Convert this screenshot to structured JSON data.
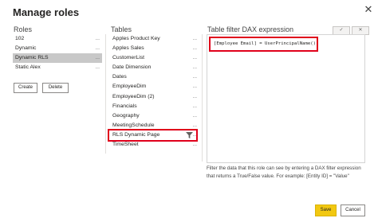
{
  "dialog": {
    "title": "Manage roles",
    "close_icon": "close-icon"
  },
  "roles": {
    "header": "Roles",
    "items": [
      {
        "label": "102",
        "dots": "...",
        "selected": false
      },
      {
        "label": "Dynamic",
        "dots": "...",
        "selected": false
      },
      {
        "label": "Dynamic RLS",
        "dots": "...",
        "selected": true
      },
      {
        "label": "Static Alex",
        "dots": "...",
        "selected": false
      }
    ],
    "create_label": "Create",
    "delete_label": "Delete"
  },
  "tables": {
    "header": "Tables",
    "items": [
      {
        "label": "Apples Product Key",
        "dots": "..."
      },
      {
        "label": "Apples Sales",
        "dots": "..."
      },
      {
        "label": "CustomerList",
        "dots": "..."
      },
      {
        "label": "Date Dimension",
        "dots": "..."
      },
      {
        "label": "Dates",
        "dots": "..."
      },
      {
        "label": "EmployeeDim",
        "dots": "..."
      },
      {
        "label": "EmployeeDim (2)",
        "dots": "..."
      },
      {
        "label": "Financials",
        "dots": "..."
      },
      {
        "label": "Geography",
        "dots": "..."
      },
      {
        "label": "MeetingSchedule",
        "dots": "..."
      },
      {
        "label": "RLS Dynamic Page",
        "dots": "...",
        "filtered": true,
        "highlighted": true
      },
      {
        "label": "TimeSheet",
        "dots": "..."
      }
    ]
  },
  "dax": {
    "header": "Table filter DAX expression",
    "check_label": "✓",
    "cancel_label": "✕",
    "expression": "[Employee Email] = UserPrincipalName()",
    "help_text": "Filter the data that this role can see by entering a DAX filter expression that returns a True/False value. For example: [Entity ID] = \"Value\""
  },
  "footer": {
    "save_label": "Save",
    "cancel_label": "Cancel"
  },
  "colors": {
    "highlight_border": "#e0001b",
    "save_button": "#f2c811",
    "selected_row": "#c8c8c8"
  }
}
